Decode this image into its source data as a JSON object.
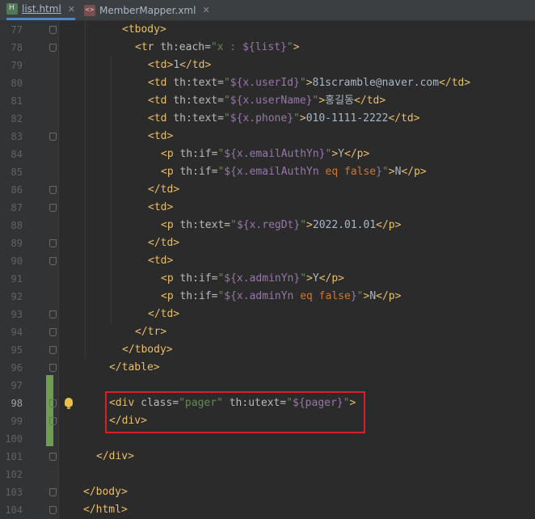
{
  "tabs": [
    {
      "name": "list.html",
      "icon": "html-file-icon",
      "active": true
    },
    {
      "name": "MemberMapper.xml",
      "icon": "xml-file-icon",
      "active": false
    }
  ],
  "close_glyph": "✕",
  "lines": [
    {
      "num": "77",
      "indent": 6,
      "fold": true,
      "tokens": [
        {
          "c": "tag",
          "t": "<tbody>"
        }
      ]
    },
    {
      "num": "78",
      "indent": 8,
      "fold": true,
      "tokens": [
        {
          "c": "tag",
          "t": "<tr "
        },
        {
          "c": "attr",
          "t": "th:each="
        },
        {
          "c": "str",
          "t": "\"x : "
        },
        {
          "c": "expr",
          "t": "${list}"
        },
        {
          "c": "str",
          "t": "\""
        },
        {
          "c": "tag",
          "t": ">"
        }
      ]
    },
    {
      "num": "79",
      "indent": 10,
      "fold": false,
      "tokens": [
        {
          "c": "tag",
          "t": "<td>"
        },
        {
          "c": "text",
          "t": "1"
        },
        {
          "c": "tag",
          "t": "</td>"
        }
      ]
    },
    {
      "num": "80",
      "indent": 10,
      "fold": false,
      "tokens": [
        {
          "c": "tag",
          "t": "<td "
        },
        {
          "c": "attr",
          "t": "th:text="
        },
        {
          "c": "str",
          "t": "\""
        },
        {
          "c": "expr",
          "t": "${x.userId}"
        },
        {
          "c": "str",
          "t": "\""
        },
        {
          "c": "tag",
          "t": ">"
        },
        {
          "c": "text",
          "t": "81scramble@naver.com"
        },
        {
          "c": "tag",
          "t": "</td>"
        }
      ]
    },
    {
      "num": "81",
      "indent": 10,
      "fold": false,
      "tokens": [
        {
          "c": "tag",
          "t": "<td "
        },
        {
          "c": "attr",
          "t": "th:text="
        },
        {
          "c": "str",
          "t": "\""
        },
        {
          "c": "expr",
          "t": "${x.userName}"
        },
        {
          "c": "str",
          "t": "\""
        },
        {
          "c": "tag",
          "t": ">"
        },
        {
          "c": "text",
          "t": "홍길동"
        },
        {
          "c": "tag",
          "t": "</td>"
        }
      ]
    },
    {
      "num": "82",
      "indent": 10,
      "fold": false,
      "tokens": [
        {
          "c": "tag",
          "t": "<td "
        },
        {
          "c": "attr",
          "t": "th:text="
        },
        {
          "c": "str",
          "t": "\""
        },
        {
          "c": "expr",
          "t": "${x.phone}"
        },
        {
          "c": "str",
          "t": "\""
        },
        {
          "c": "tag",
          "t": ">"
        },
        {
          "c": "text",
          "t": "010-1111-2222"
        },
        {
          "c": "tag",
          "t": "</td>"
        }
      ]
    },
    {
      "num": "83",
      "indent": 10,
      "fold": true,
      "tokens": [
        {
          "c": "tag",
          "t": "<td>"
        }
      ]
    },
    {
      "num": "84",
      "indent": 12,
      "fold": false,
      "tokens": [
        {
          "c": "tag",
          "t": "<p "
        },
        {
          "c": "attr",
          "t": "th:if="
        },
        {
          "c": "str",
          "t": "\""
        },
        {
          "c": "expr",
          "t": "${x.emailAuthYn}"
        },
        {
          "c": "str",
          "t": "\""
        },
        {
          "c": "tag",
          "t": ">"
        },
        {
          "c": "text",
          "t": "Y"
        },
        {
          "c": "tag",
          "t": "</p>"
        }
      ]
    },
    {
      "num": "85",
      "indent": 12,
      "fold": false,
      "tokens": [
        {
          "c": "tag",
          "t": "<p "
        },
        {
          "c": "attr",
          "t": "th:if="
        },
        {
          "c": "str",
          "t": "\""
        },
        {
          "c": "expr",
          "t": "${x.emailAuthYn "
        },
        {
          "c": "kw",
          "t": "eq false"
        },
        {
          "c": "expr",
          "t": "}"
        },
        {
          "c": "str",
          "t": "\""
        },
        {
          "c": "tag",
          "t": ">"
        },
        {
          "c": "text",
          "t": "N"
        },
        {
          "c": "tag",
          "t": "</p>"
        }
      ]
    },
    {
      "num": "86",
      "indent": 10,
      "fold": true,
      "tokens": [
        {
          "c": "tag",
          "t": "</td>"
        }
      ]
    },
    {
      "num": "87",
      "indent": 10,
      "fold": true,
      "tokens": [
        {
          "c": "tag",
          "t": "<td>"
        }
      ]
    },
    {
      "num": "88",
      "indent": 12,
      "fold": false,
      "tokens": [
        {
          "c": "tag",
          "t": "<p "
        },
        {
          "c": "attr",
          "t": "th:text="
        },
        {
          "c": "str",
          "t": "\""
        },
        {
          "c": "expr",
          "t": "${x.regDt}"
        },
        {
          "c": "str",
          "t": "\""
        },
        {
          "c": "tag",
          "t": ">"
        },
        {
          "c": "text",
          "t": "2022.01.01"
        },
        {
          "c": "tag",
          "t": "</p>"
        }
      ]
    },
    {
      "num": "89",
      "indent": 10,
      "fold": true,
      "tokens": [
        {
          "c": "tag",
          "t": "</td>"
        }
      ]
    },
    {
      "num": "90",
      "indent": 10,
      "fold": true,
      "tokens": [
        {
          "c": "tag",
          "t": "<td>"
        }
      ]
    },
    {
      "num": "91",
      "indent": 12,
      "fold": false,
      "tokens": [
        {
          "c": "tag",
          "t": "<p "
        },
        {
          "c": "attr",
          "t": "th:if="
        },
        {
          "c": "str",
          "t": "\""
        },
        {
          "c": "expr",
          "t": "${x.adminYn}"
        },
        {
          "c": "str",
          "t": "\""
        },
        {
          "c": "tag",
          "t": ">"
        },
        {
          "c": "text",
          "t": "Y"
        },
        {
          "c": "tag",
          "t": "</p>"
        }
      ]
    },
    {
      "num": "92",
      "indent": 12,
      "fold": false,
      "tokens": [
        {
          "c": "tag",
          "t": "<p "
        },
        {
          "c": "attr",
          "t": "th:if="
        },
        {
          "c": "str",
          "t": "\""
        },
        {
          "c": "expr",
          "t": "${x.adminYn "
        },
        {
          "c": "kw",
          "t": "eq false"
        },
        {
          "c": "expr",
          "t": "}"
        },
        {
          "c": "str",
          "t": "\""
        },
        {
          "c": "tag",
          "t": ">"
        },
        {
          "c": "text",
          "t": "N"
        },
        {
          "c": "tag",
          "t": "</p>"
        }
      ]
    },
    {
      "num": "93",
      "indent": 10,
      "fold": true,
      "tokens": [
        {
          "c": "tag",
          "t": "</td>"
        }
      ]
    },
    {
      "num": "94",
      "indent": 8,
      "fold": true,
      "tokens": [
        {
          "c": "tag",
          "t": "</tr>"
        }
      ]
    },
    {
      "num": "95",
      "indent": 6,
      "fold": true,
      "tokens": [
        {
          "c": "tag",
          "t": "</tbody>"
        }
      ]
    },
    {
      "num": "96",
      "indent": 4,
      "fold": true,
      "tokens": [
        {
          "c": "tag",
          "t": "</table>"
        }
      ]
    },
    {
      "num": "97",
      "indent": 0,
      "fold": false,
      "tokens": []
    },
    {
      "num": "98",
      "indent": 4,
      "fold": true,
      "current": true,
      "bulb": true,
      "tokens": [
        {
          "c": "tag",
          "t": "<div "
        },
        {
          "c": "attr",
          "t": "class="
        },
        {
          "c": "str",
          "t": "\"pager\" "
        },
        {
          "c": "attr",
          "t": "th:utext="
        },
        {
          "c": "str",
          "t": "\""
        },
        {
          "c": "expr",
          "t": "${pager}"
        },
        {
          "c": "str",
          "t": "\""
        },
        {
          "c": "tag",
          "t": ">"
        }
      ]
    },
    {
      "num": "99",
      "indent": 4,
      "fold": true,
      "tokens": [
        {
          "c": "tag",
          "t": "</div>"
        }
      ]
    },
    {
      "num": "100",
      "indent": 0,
      "fold": false,
      "tokens": []
    },
    {
      "num": "101",
      "indent": 2,
      "fold": true,
      "tokens": [
        {
          "c": "tag",
          "t": "</div>"
        }
      ]
    },
    {
      "num": "102",
      "indent": 0,
      "fold": false,
      "tokens": []
    },
    {
      "num": "103",
      "indent": 0,
      "fold": true,
      "tokens": [
        {
          "c": "tag",
          "t": "</body>"
        }
      ]
    },
    {
      "num": "104",
      "indent": 0,
      "fold": true,
      "tokens": [
        {
          "c": "tag",
          "t": "</html>"
        }
      ]
    }
  ],
  "colors": {
    "editor_bg": "#2b2b2b",
    "gutter_bg": "#313335",
    "tag": "#e8bf6a",
    "attr": "#bababa",
    "string": "#6a8759",
    "expression": "#9876aa",
    "keyword": "#cc7832",
    "text": "#a9b7c6",
    "change_marker": "#6d9e52",
    "highlight_box": "#d8202a"
  }
}
